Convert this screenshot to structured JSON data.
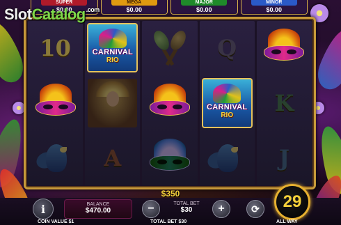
{
  "logo": {
    "word1": "Slot",
    "word2": "Catalog",
    "suffix": ".com"
  },
  "jackpots": [
    {
      "label": "SUPER",
      "value": "$0.00"
    },
    {
      "label": "MEGA",
      "value": "$0.00"
    },
    {
      "label": "MAJOR",
      "value": "$0.00"
    },
    {
      "label": "MINOR",
      "value": "$0.00"
    }
  ],
  "reels": [
    [
      {
        "type": "letter",
        "text": "10"
      },
      {
        "type": "mask"
      },
      {
        "type": "parrot"
      }
    ],
    [
      {
        "type": "wild",
        "text1": "CARNIVAL",
        "text2": "RIO"
      },
      {
        "type": "dancer"
      },
      {
        "type": "letter",
        "text": "A"
      }
    ],
    [
      {
        "type": "maracas"
      },
      {
        "type": "mask"
      },
      {
        "type": "mask_dim"
      }
    ],
    [
      {
        "type": "letter",
        "text": "Q"
      },
      {
        "type": "wild",
        "text1": "CARNIVAL",
        "text2": "RIO"
      },
      {
        "type": "parrot"
      }
    ],
    [
      {
        "type": "mask"
      },
      {
        "type": "letter",
        "text": "K"
      },
      {
        "type": "letter",
        "text": "J"
      }
    ]
  ],
  "win_amount": "$350",
  "controls": {
    "info_label": "i",
    "balance_label": "BALANCE",
    "balance_value": "$470.00",
    "minus_label": "−",
    "total_bet_label": "TOTAL BET",
    "total_bet_value": "$30",
    "plus_label": "+",
    "autoplay_label": "⟳",
    "spin_label": "29"
  },
  "footer": {
    "coin_value": "COIN VALUE $1",
    "total_bet": "TOTAL BET $30",
    "ways": "ALL WAY"
  },
  "colors": {
    "super": "#b01a2a",
    "mega": "#e09a10",
    "major": "#1f8a2a",
    "minor": "#2a5ac8",
    "gold": "#f6d23a"
  }
}
